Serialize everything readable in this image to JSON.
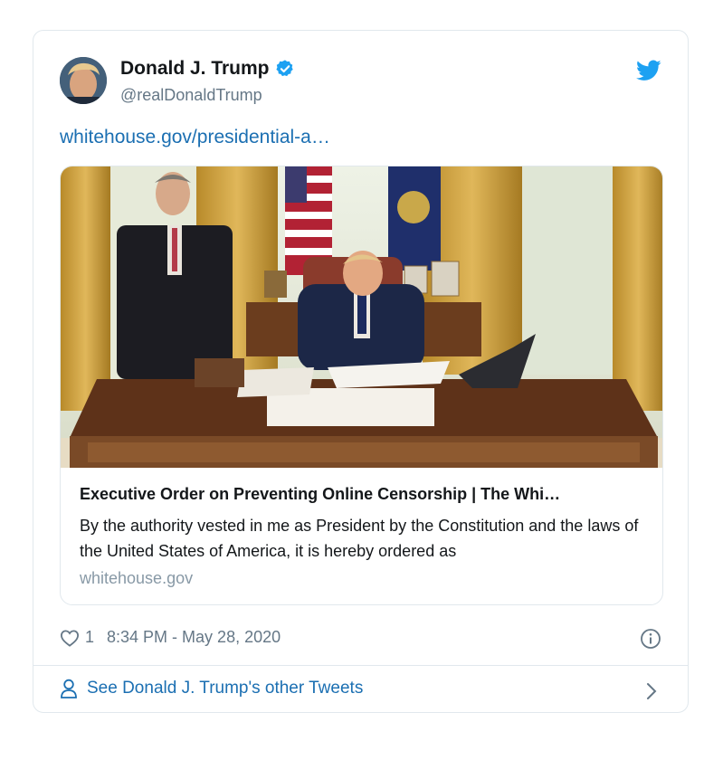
{
  "tweet": {
    "author_name": "Donald J. Trump",
    "author_handle": "@realDonaldTrump",
    "link_text": "whitehouse.gov/presidential-a…",
    "card": {
      "title": "Executive Order on Preventing Online Censorship | The Whi…",
      "description": "By the authority vested in me as President by the Constitution and the laws of the United States of America, it is hereby ordered as",
      "domain": "whitehouse.gov"
    },
    "like_count": "1",
    "timestamp": "8:34 PM - May 28, 2020",
    "footer_link": "See Donald J. Trump's other Tweets"
  },
  "icons": {
    "verified": "verified-badge-icon",
    "twitter": "twitter-bird-icon",
    "like": "heart-icon",
    "info": "info-icon",
    "profile": "person-icon",
    "more": "chevron-right-icon"
  },
  "colors": {
    "link": "#1b6fb2",
    "twitter_blue": "#1da1f2",
    "secondary_text": "#657786",
    "border": "#e1e8ed"
  }
}
